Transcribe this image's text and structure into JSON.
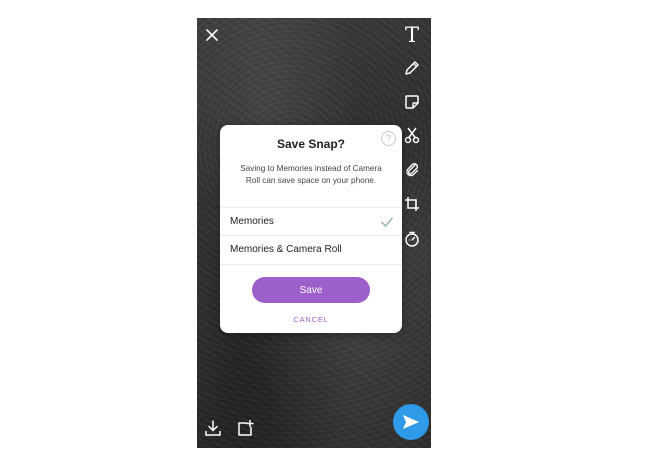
{
  "dialog": {
    "title": "Save Snap?",
    "help_glyph": "?",
    "description": "Saving to Memories instead of Camera Roll can save space on your phone.",
    "options": [
      {
        "label": "Memories",
        "selected": true
      },
      {
        "label": "Memories & Camera Roll",
        "selected": false
      }
    ],
    "save_label": "Save",
    "cancel_label": "CANCEL"
  },
  "toolbar": {
    "text_glyph": "T",
    "icons": [
      "text-tool-icon",
      "pencil-icon",
      "sticker-icon",
      "scissors-icon",
      "paperclip-icon",
      "crop-icon",
      "timer-icon"
    ]
  },
  "colors": {
    "accent": "#9d5fc9",
    "send": "#2f9be8",
    "check": "#8fb3a8"
  }
}
